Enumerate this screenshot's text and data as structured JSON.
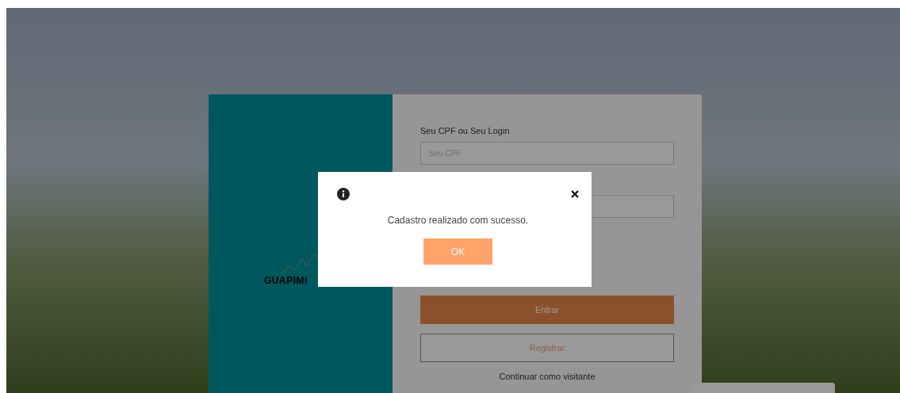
{
  "login": {
    "logo": {
      "text": "GUAPIMI"
    },
    "field": {
      "label": "Seu CPF ou Seu Login",
      "placeholder": "Seu CPF"
    },
    "buttons": [
      {
        "label": "Entrar",
        "kind": "primary"
      },
      {
        "label": "Registrar",
        "kind": "outline"
      }
    ],
    "guest_link": "Continuar como visitante"
  },
  "dialog": {
    "message": "Cadastro realizado com sucesso.",
    "button": "OK"
  }
}
